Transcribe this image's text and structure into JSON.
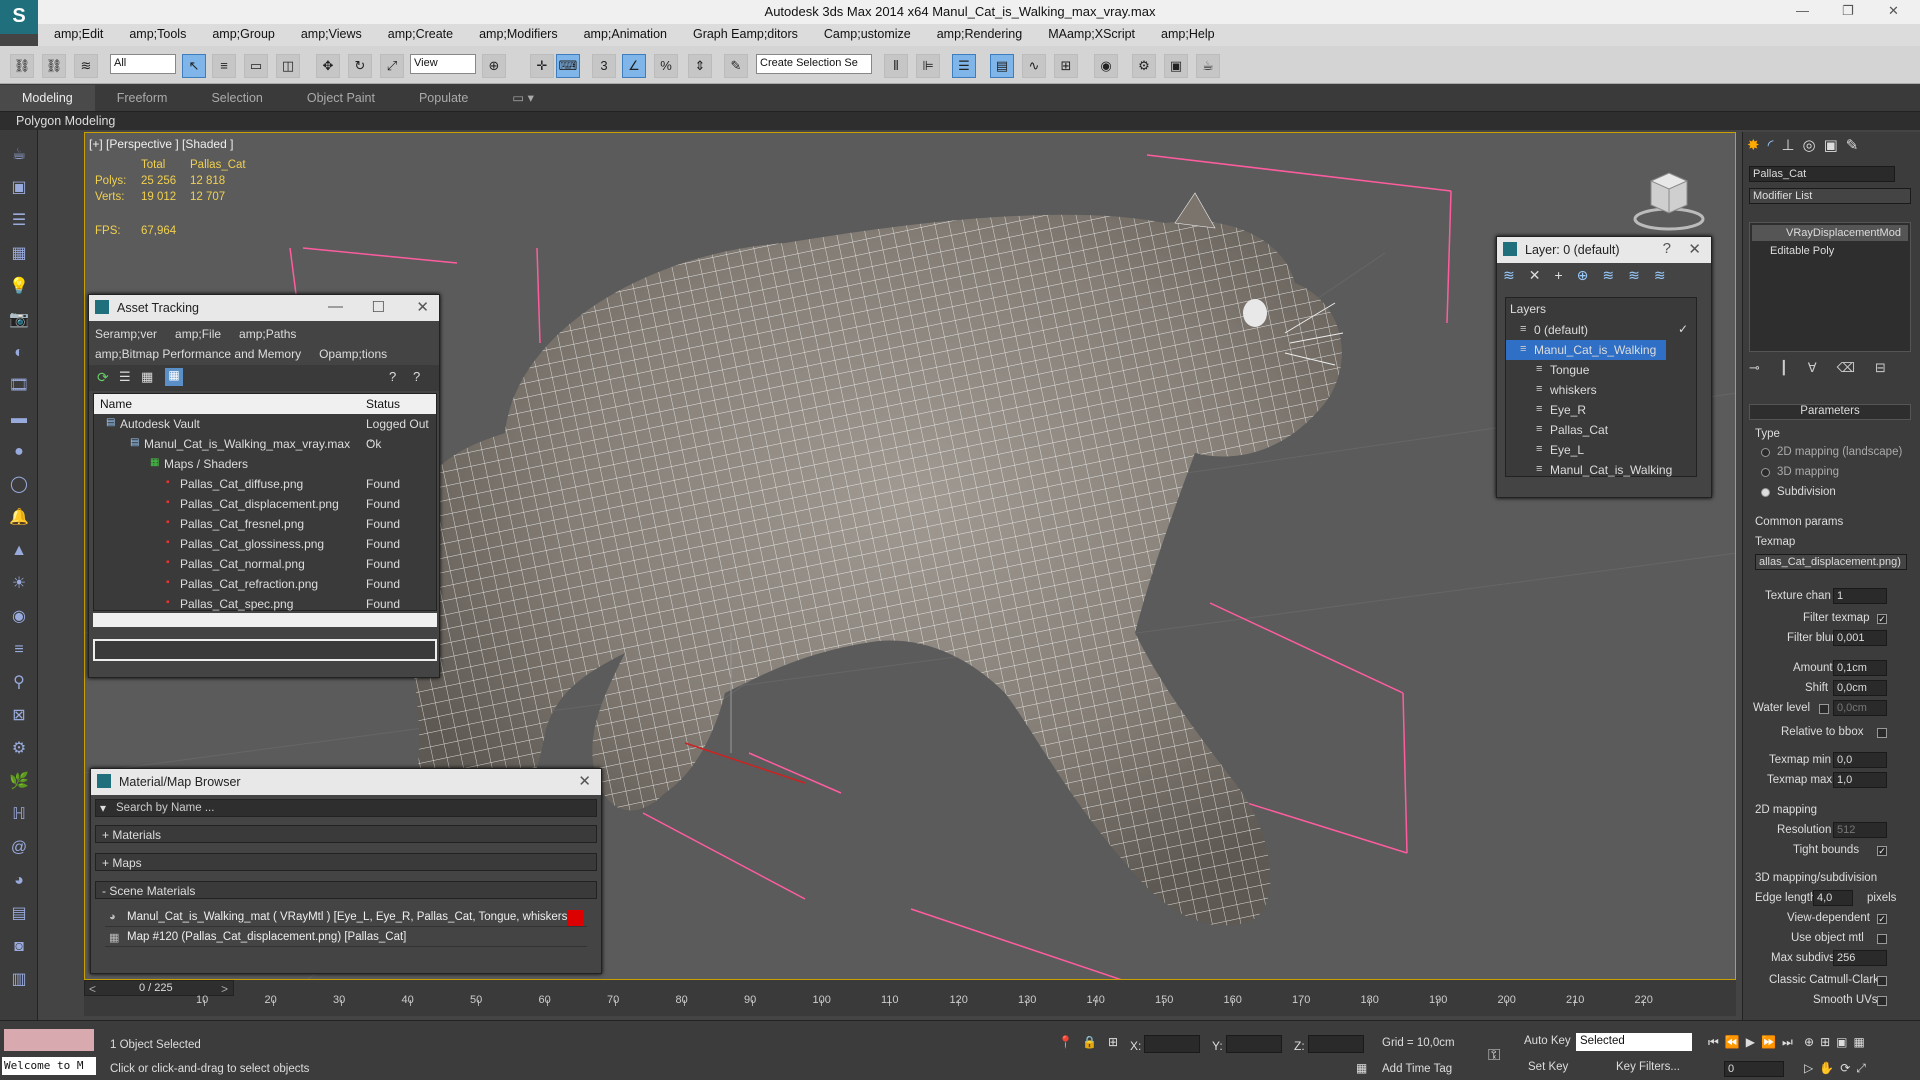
{
  "window": {
    "title": "Autodesk 3ds Max  2014 x64     Manul_Cat_is_Walking_max_vray.max",
    "app_icon": "3dsmax-logo"
  },
  "menu": [
    "amp;Edit",
    "amp;Tools",
    "amp;Group",
    "amp;Views",
    "amp;Create",
    "amp;Modifiers",
    "amp;Animation",
    "Graph Eamp;ditors",
    "Camp;ustomize",
    "amp;Rendering",
    "MAamp;XScript",
    "amp;Help"
  ],
  "toolbar": {
    "selection_filter": "All",
    "ref_coord": "View",
    "named_sel": "Create Selection Se"
  },
  "ribbon": {
    "tabs": [
      "Modeling",
      "Freeform",
      "Selection",
      "Object Paint",
      "Populate"
    ],
    "active": "Modeling",
    "sub": "Polygon Modeling"
  },
  "viewport": {
    "label": "[+] [Perspective ] [Shaded ]",
    "stats": {
      "col_total": "Total",
      "col_obj": "Pallas_Cat",
      "polys_label": "Polys:",
      "polys_total": "25 256",
      "polys_obj": "12 818",
      "verts_label": "Verts:",
      "verts_total": "19 012",
      "verts_obj": "12 707",
      "fps_label": "FPS:",
      "fps": "67,964"
    }
  },
  "asset_tracking": {
    "title": "Asset Tracking",
    "menu1": [
      "Seramp;ver",
      "amp;File",
      "amp;Paths"
    ],
    "menu2": [
      "amp;Bitmap Performance and Memory",
      "Opamp;tions"
    ],
    "columns": [
      "Name",
      "Status"
    ],
    "rows": [
      {
        "name": "Autodesk Vault",
        "status": "Logged Out ..",
        "indent": 0
      },
      {
        "name": "Manul_Cat_is_Walking_max_vray.max",
        "status": "Ok",
        "indent": 1
      },
      {
        "name": "Maps / Shaders",
        "status": "",
        "indent": 2
      },
      {
        "name": "Pallas_Cat_diffuse.png",
        "status": "Found",
        "indent": 3
      },
      {
        "name": "Pallas_Cat_displacement.png",
        "status": "Found",
        "indent": 3
      },
      {
        "name": "Pallas_Cat_fresnel.png",
        "status": "Found",
        "indent": 3
      },
      {
        "name": "Pallas_Cat_glossiness.png",
        "status": "Found",
        "indent": 3
      },
      {
        "name": "Pallas_Cat_normal.png",
        "status": "Found",
        "indent": 3
      },
      {
        "name": "Pallas_Cat_refraction.png",
        "status": "Found",
        "indent": 3
      },
      {
        "name": "Pallas_Cat_spec.png",
        "status": "Found",
        "indent": 3
      }
    ]
  },
  "layer_panel": {
    "title": "Layer: 0 (default)",
    "header": "Layers",
    "items": [
      {
        "name": "0 (default)",
        "level": 0,
        "selected": false
      },
      {
        "name": "Manul_Cat_is_Walking",
        "level": 0,
        "selected": true
      },
      {
        "name": "Tongue",
        "level": 1,
        "selected": false
      },
      {
        "name": "whiskers",
        "level": 1,
        "selected": false
      },
      {
        "name": "Eye_R",
        "level": 1,
        "selected": false
      },
      {
        "name": "Pallas_Cat",
        "level": 1,
        "selected": false
      },
      {
        "name": "Eye_L",
        "level": 1,
        "selected": false
      },
      {
        "name": "Manul_Cat_is_Walking",
        "level": 1,
        "selected": false
      }
    ]
  },
  "material_browser": {
    "title": "Material/Map Browser",
    "search_placeholder": "Search by Name ...",
    "groups": [
      "+ Materials",
      "+ Maps",
      "- Scene Materials"
    ],
    "entries": [
      "Manul_Cat_is_Walking_mat  ( VRayMtl ) [Eye_L, Eye_R, Pallas_Cat, Tongue, whiskers]",
      "Map #120 (Pallas_Cat_displacement.png) [Pallas_Cat]"
    ]
  },
  "command_panel": {
    "object_name": "Pallas_Cat",
    "modifier_list": "Modifier List",
    "stack": [
      "VRayDisplacementMod",
      "Editable Poly"
    ],
    "parameters_title": "Parameters",
    "type_label": "Type",
    "type_options": [
      "2D mapping (landscape)",
      "3D mapping",
      "Subdivision"
    ],
    "type_selected": 2,
    "common_params": "Common params",
    "texmap_label": "Texmap",
    "texmap_value": "allas_Cat_displacement.png)",
    "texture_chan_label": "Texture chan",
    "texture_chan": "1",
    "filter_texmap_label": "Filter texmap",
    "filter_blur_label": "Filter blur",
    "filter_blur": "0,001",
    "amount_label": "Amount",
    "amount": "0,1cm",
    "shift_label": "Shift",
    "shift": "0,0cm",
    "water_level_label": "Water level",
    "water_level": "0,0cm",
    "relative_bbox_label": "Relative to bbox",
    "texmap_min_label": "Texmap min",
    "texmap_min": "0,0",
    "texmap_max_label": "Texmap max",
    "texmap_max": "1,0",
    "mapping2d_label": "2D mapping",
    "resolution_label": "Resolution",
    "resolution": "512",
    "tight_bounds_label": "Tight bounds",
    "mapping3d_label": "3D mapping/subdivision",
    "edge_length_label": "Edge length",
    "edge_length": "4,0",
    "pixels_label": "pixels",
    "view_dependent_label": "View-dependent",
    "use_object_mtl_label": "Use object mtl",
    "max_subdivs_label": "Max subdivs",
    "max_subdivs": "256",
    "classic_cc_label": "Classic Catmull-Clark",
    "smooth_uvs_label": "Smooth UVs"
  },
  "timeline": {
    "frame": "0 / 225",
    "ticks": [
      "10",
      "20",
      "30",
      "40",
      "50",
      "60",
      "70",
      "80",
      "90",
      "100",
      "110",
      "120",
      "130",
      "140",
      "150",
      "160",
      "170",
      "180",
      "190",
      "200",
      "210",
      "220"
    ]
  },
  "status": {
    "selected": "1 Object Selected",
    "prompt": "Click or click-and-drag to select objects",
    "welcome": "Welcome to M",
    "x_label": "X:",
    "y_label": "Y:",
    "z_label": "Z:",
    "grid": "Grid = 10,0cm",
    "add_time_tag": "Add Time Tag",
    "auto_key": "Auto Key",
    "set_key": "Set Key",
    "key_mode": "Selected",
    "key_filters": "Key Filters...",
    "frame_value": "0"
  }
}
